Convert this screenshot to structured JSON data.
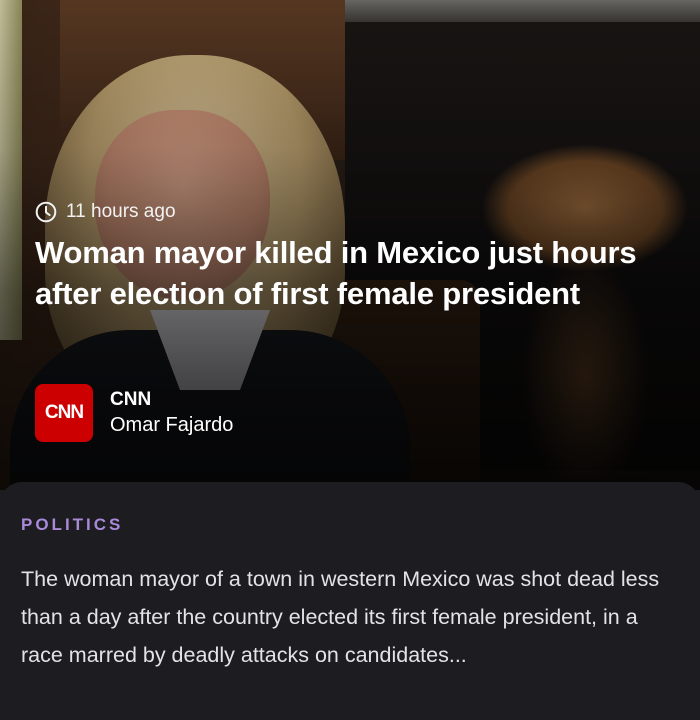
{
  "article": {
    "time_ago": "11 hours ago",
    "headline": "Woman mayor killed in Mexico just hours after election of first female president",
    "source_logo_text": "CNN",
    "source_name": "CNN",
    "author": "Omar Fajardo",
    "category": "POLITICS",
    "summary": "The woman mayor of a town in western Mexico was shot dead less than a day after the country elected its first female president, in a race marred by deadly attacks on candidates..."
  },
  "icons": {
    "time": "clock-icon"
  },
  "colors": {
    "source_logo_bg": "#cc0000",
    "category": "#a98ad8",
    "panel_bg": "#1d1c21"
  }
}
